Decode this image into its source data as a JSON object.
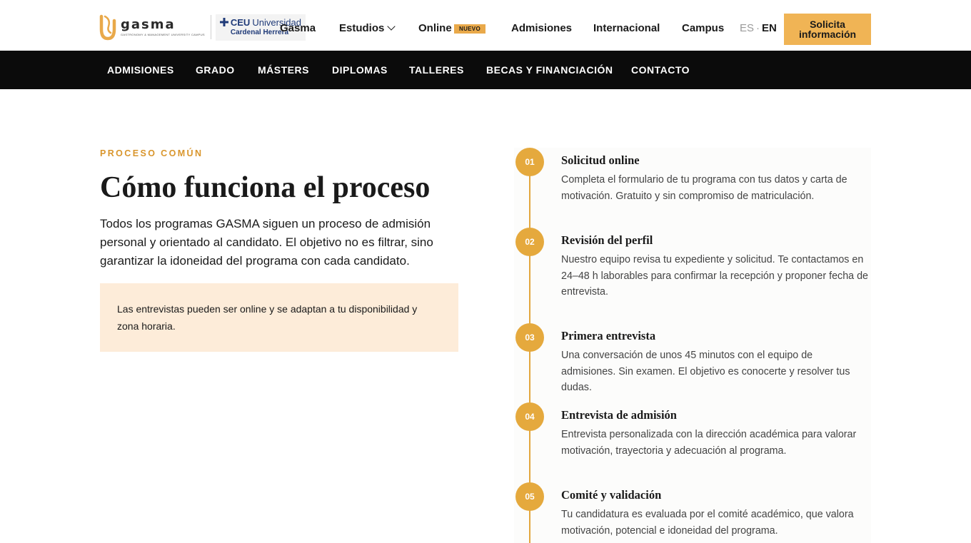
{
  "header": {
    "logo": {
      "name": "gasma",
      "tagline": "GASTRONOMY & MANAGEMENT UNIVERSITY CAMPUS"
    },
    "partner": {
      "ceu": "CEU",
      "universidad": "Universidad",
      "campus": "Cardenal Herrera"
    },
    "nav": [
      {
        "label": "Gasma"
      },
      {
        "label": "Estudios"
      },
      {
        "label": "Online"
      },
      {
        "label": "Admisiones"
      },
      {
        "label": "Internacional"
      },
      {
        "label": "Campus"
      }
    ],
    "online_badge": "NUEVO",
    "lang": {
      "es": "ES",
      "separator": "·",
      "en": "EN"
    },
    "cta": {
      "line1": "Solicita",
      "line2": "información"
    }
  },
  "subnav": [
    {
      "label": "ADMISIONES"
    },
    {
      "label": "GRADO"
    },
    {
      "label": "MÁSTERS"
    },
    {
      "label": "DIPLOMAS"
    },
    {
      "label": "TALLERES"
    },
    {
      "label": "BECAS Y FINANCIACIÓN"
    },
    {
      "label": "CONTACTO"
    }
  ],
  "main": {
    "eyebrow": "PROCESO COMÚN",
    "title": "Cómo funciona el proceso",
    "intro": "Todos los programas GASMA siguen un proceso de admisión personal y orientado al candidato. El objetivo no es filtrar, sino garantizar la idoneidad del programa con cada candidato.",
    "notice": "Las entrevistas pueden ser online y se adaptan a tu disponibilidad y zona horaria."
  },
  "steps": [
    {
      "num": "01",
      "title": "Solicitud online",
      "desc": "Completa el formulario de tu programa con tus datos y carta de motivación. Gratuito y sin compromiso de matriculación."
    },
    {
      "num": "02",
      "title": "Revisión del perfil",
      "desc": "Nuestro equipo revisa tu expediente y solicitud. Te contactamos en 24–48 h laborables para confirmar la recepción y proponer fecha de entrevista."
    },
    {
      "num": "03",
      "title": "Primera entrevista",
      "desc": "Una conversación de unos 45 minutos con el equipo de admisiones. Sin examen. El objetivo es conocerte y resolver tus dudas."
    },
    {
      "num": "04",
      "title": "Entrevista de admisión",
      "desc": "Entrevista personalizada con la dirección académica para valorar motivación, trayectoria y adecuación al programa."
    },
    {
      "num": "05",
      "title": "Comité y validación",
      "desc": "Tu candidatura es evaluada por el comité académico, que valora motivación, potencial e idoneidad del programa."
    }
  ],
  "colors": {
    "accent": "#e5a93d",
    "eyebrow": "#d9962d",
    "cta": "#f0b455",
    "notice_bg": "#fdecd9",
    "subnav_bg": "#0b0b0b",
    "brand_blue": "#1f3a78"
  }
}
